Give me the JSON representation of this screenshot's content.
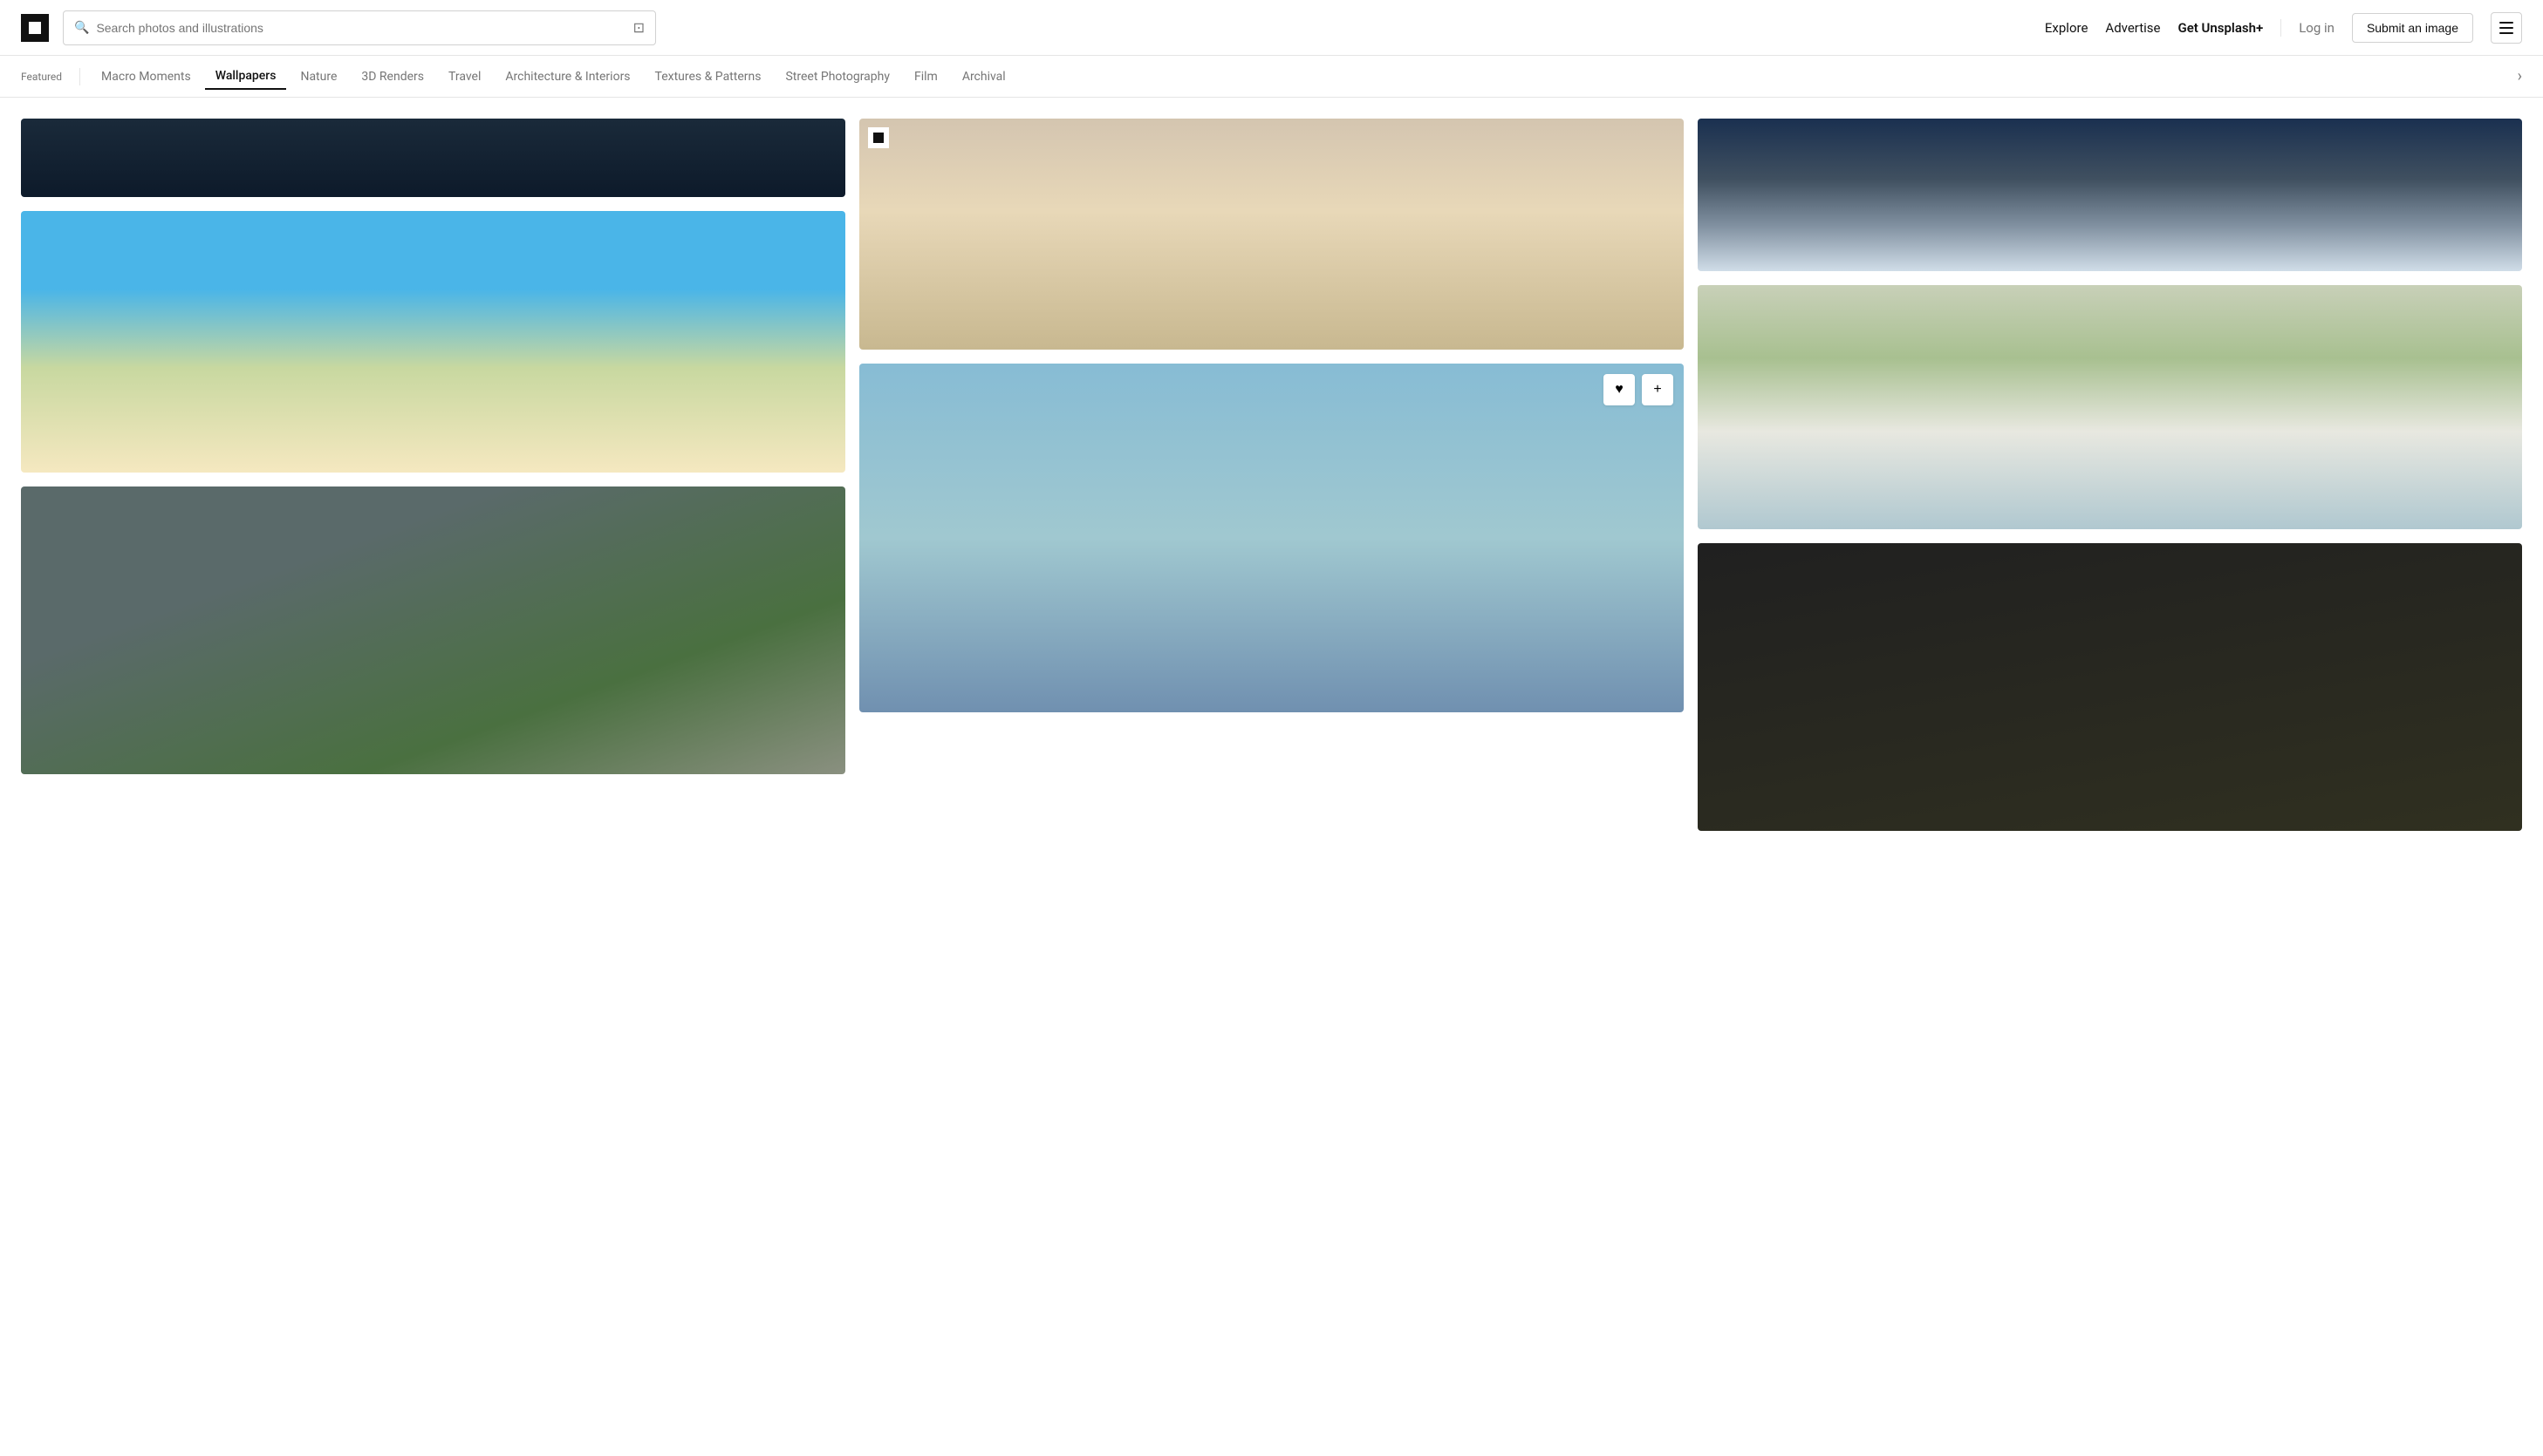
{
  "header": {
    "logo_alt": "Unsplash",
    "search_placeholder": "Search photos and illustrations",
    "nav_items": [
      {
        "label": "Explore",
        "href": "#"
      },
      {
        "label": "Advertise",
        "href": "#"
      },
      {
        "label": "Get Unsplash+",
        "href": "#",
        "bold": true
      }
    ],
    "log_in": "Log in",
    "submit": "Submit an image"
  },
  "subnav": {
    "featured_label": "Featured",
    "items": [
      {
        "label": "Macro Moments",
        "active": false
      },
      {
        "label": "Wallpapers",
        "active": true
      },
      {
        "label": "Nature",
        "active": false
      },
      {
        "label": "3D Renders",
        "active": false
      },
      {
        "label": "Travel",
        "active": false
      },
      {
        "label": "Architecture & Interiors",
        "active": false
      },
      {
        "label": "Textures & Patterns",
        "active": false
      },
      {
        "label": "Street Photography",
        "active": false
      },
      {
        "label": "Film",
        "active": false
      },
      {
        "label": "Archival",
        "active": false
      }
    ]
  },
  "photos": {
    "like_label": "♥",
    "add_label": "+"
  }
}
